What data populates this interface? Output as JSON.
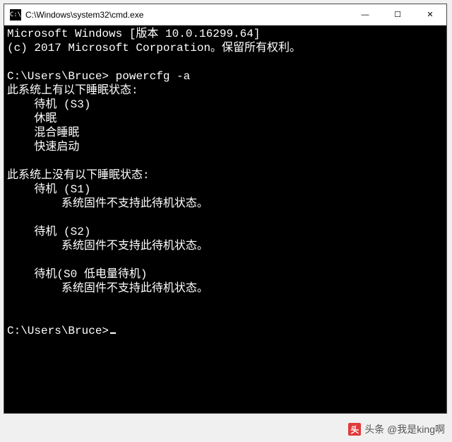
{
  "window": {
    "title": "C:\\Windows\\system32\\cmd.exe",
    "icon_glyph": "C:\\",
    "controls": {
      "min": "—",
      "max": "☐",
      "close": "✕"
    }
  },
  "terminal": {
    "banner1": "Microsoft Windows [版本 10.0.16299.64]",
    "banner2": "(c) 2017 Microsoft Corporation。保留所有权利。",
    "prompt1_path": "C:\\Users\\Bruce>",
    "prompt1_cmd": " powercfg -a",
    "avail_header": "此系统上有以下睡眠状态:",
    "avail": [
      "待机 (S3)",
      "休眠",
      "混合睡眠",
      "快速启动"
    ],
    "unavail_header": "此系统上没有以下睡眠状态:",
    "unavail": [
      {
        "name": "待机 (S1)",
        "reason": "系统固件不支持此待机状态。"
      },
      {
        "name": "待机 (S2)",
        "reason": "系统固件不支持此待机状态。"
      },
      {
        "name": "待机(S0 低电量待机)",
        "reason": "系统固件不支持此待机状态。"
      }
    ],
    "prompt2_path": "C:\\Users\\Bruce>"
  },
  "watermark": {
    "logo": "头",
    "text": "头条 @我是king啊"
  }
}
